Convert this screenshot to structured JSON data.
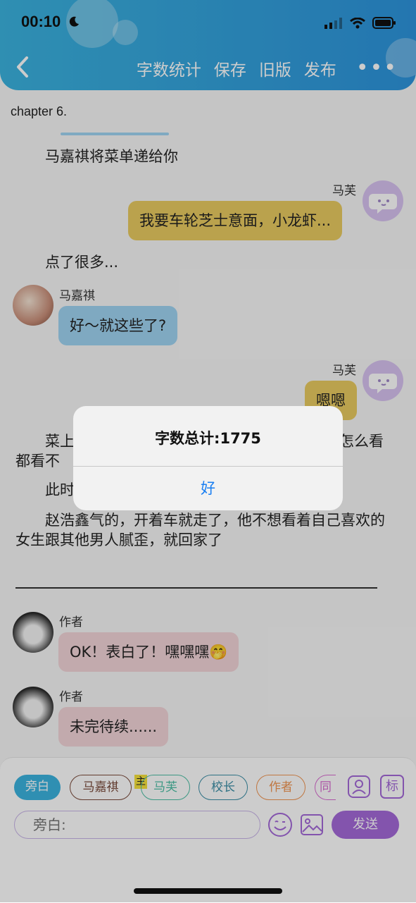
{
  "status": {
    "time": "00:10"
  },
  "nav": {
    "items": [
      "字数统计",
      "保存",
      "旧版",
      "发布"
    ],
    "more": "•••"
  },
  "chapter": "chapter 6.",
  "story": {
    "narration1": "马嘉祺将菜单递给你",
    "msg1": {
      "sender": "马芙",
      "text": "我要车轮芝士意面，小龙虾..."
    },
    "narration2": "点了很多...",
    "msg2": {
      "sender": "马嘉祺",
      "text": "好～就这些了?"
    },
    "msg3": {
      "sender": "马芙",
      "text": "嗯嗯"
    },
    "narration3": "菜上",
    "narration3_tail": "怎么看",
    "narration3_line2": "都看不",
    "narration4": "此时",
    "narration5": "赵浩鑫气的，开着车就走了，他不想看着自己喜欢的女生跟其他男人腻歪，就回家了",
    "msg4": {
      "sender": "作者",
      "text": "OK！表白了！嘿嘿嘿🤭"
    },
    "msg5": {
      "sender": "作者",
      "text": "未完待续......"
    }
  },
  "alert": {
    "title": "字数总计:1775",
    "ok": "好"
  },
  "bottom": {
    "tags": [
      "旁白",
      "马嘉祺",
      "马芙",
      "校长",
      "作者",
      "同"
    ],
    "main_badge": "主",
    "tool_icons": [
      "profile-icon",
      "mark-icon"
    ],
    "mark_label": "标",
    "input_placeholder": "旁白:",
    "send": "发送"
  },
  "colors": {
    "header": "#2d94dc",
    "bubble_yellow": "#e9cb61",
    "bubble_blue": "#9fd4f2",
    "bubble_pink": "#f3d5d9",
    "send": "#a46ad9",
    "alert_link": "#1a7ff2"
  }
}
